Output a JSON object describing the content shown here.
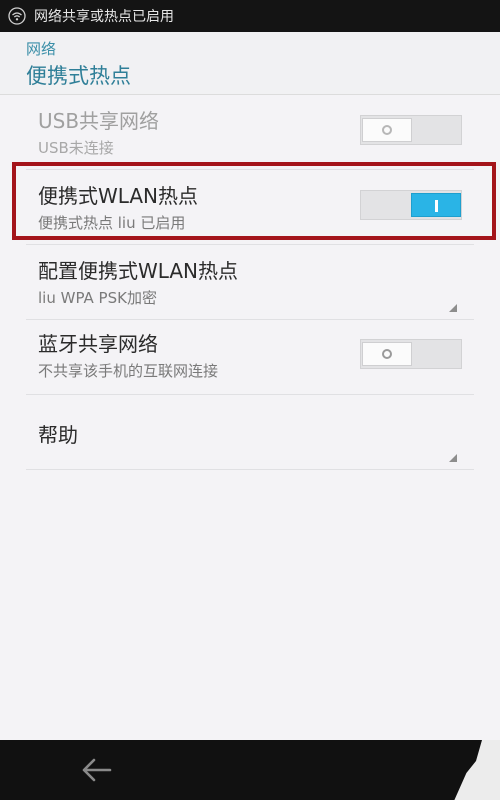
{
  "status_bar": {
    "text": "网络共享或热点已启用",
    "icon": "wifi-hotspot-icon"
  },
  "header": {
    "breadcrumb": "网络",
    "title": "便携式热点"
  },
  "items": [
    {
      "title": "USB共享网络",
      "subtitle": "USB未连接",
      "toggle": "off",
      "enabled": false
    },
    {
      "title": "便携式WLAN热点",
      "subtitle": "便携式热点 liu 已启用",
      "toggle": "on",
      "enabled": true,
      "highlighted": true
    },
    {
      "title": "配置便携式WLAN热点",
      "subtitle": "liu WPA PSK加密",
      "has_corner_arrow": true
    },
    {
      "title": "蓝牙共享网络",
      "subtitle": "不共享该手机的互联网连接",
      "toggle": "off",
      "enabled": true
    },
    {
      "title": "帮助",
      "has_corner_arrow": true
    }
  ],
  "nav": {
    "back_icon": "back-arrow-icon"
  },
  "colors": {
    "accent": "#2ab4e6",
    "header_text": "#2f7f98",
    "highlight": "#a4141b"
  }
}
